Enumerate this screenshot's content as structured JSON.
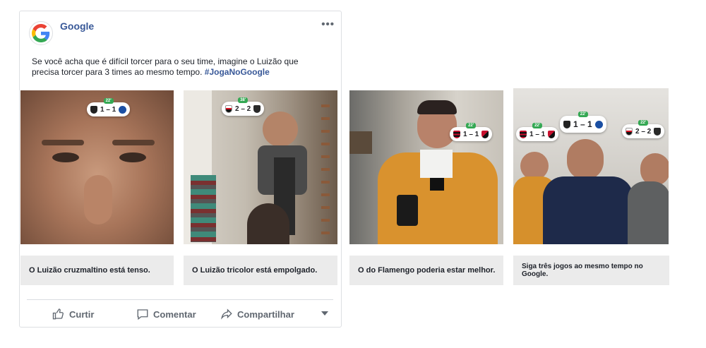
{
  "post": {
    "page_name": "Google",
    "avatar_icon": "google-g-logo",
    "more_icon": "•••",
    "text": "Se você acha que é difícil torcer para o seu time, imagine o Luizão que precisa torcer para 3 times ao mesmo tempo. ",
    "hashtag": "#JogaNoGoogle"
  },
  "slides": [
    {
      "caption": "O Luizão cruzmaltino está tenso.",
      "scores": [
        {
          "live": "22'",
          "score": "1 – 1",
          "home": "vasco",
          "away": "cruzeiro"
        }
      ]
    },
    {
      "caption": "O Luizão tricolor está empolgado.",
      "scores": [
        {
          "live": "38'",
          "score": "2 – 2",
          "home": "saopaulo",
          "away": "atletico"
        }
      ]
    },
    {
      "caption": "O do Flamengo poderia estar melhor.",
      "scores": [
        {
          "live": "22'",
          "score": "1 – 1",
          "home": "flamengo",
          "away": "athletico"
        }
      ]
    },
    {
      "caption": "Siga três jogos ao mesmo tempo no Google.",
      "scores": [
        {
          "live": "22'",
          "score": "1 – 1",
          "home": "vasco",
          "away": "cruzeiro"
        },
        {
          "live": "22'",
          "score": "1 – 1",
          "home": "flamengo",
          "away": "athletico"
        },
        {
          "live": "22'",
          "score": "2 – 2",
          "home": "saopaulo",
          "away": "atletico"
        }
      ]
    }
  ],
  "actions": {
    "like": "Curtir",
    "comment": "Comentar",
    "share": "Compartilhar"
  },
  "colors": {
    "link": "#385898",
    "action_gray": "#606770",
    "caption_bg": "#ebebeb",
    "live_green": "#34a853"
  }
}
